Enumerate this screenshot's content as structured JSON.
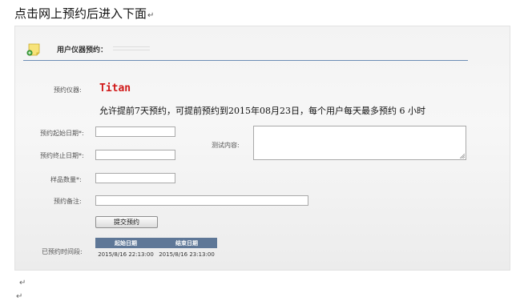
{
  "doc": {
    "heading": "点击网上预约后进入下面",
    "return_mark": "↵"
  },
  "panel": {
    "title": "用户仪器预约："
  },
  "form": {
    "instrument_label": "预约仪器:",
    "instrument_name": "Titan",
    "notice": "允许提前7天预约，可提前预约到2015年08月23日，每个用户每天最多预约 6 小时",
    "start_label": "预约起始日期*:",
    "start_value": "",
    "end_label": "预约终止日期*:",
    "end_value": "",
    "qty_label": "样品数量*:",
    "qty_value": "",
    "remark_label": "预约备注:",
    "remark_value": "",
    "content_label": "测试内容:",
    "content_value": "",
    "submit_label": "提交预约"
  },
  "booked": {
    "label": "已预约时间段:",
    "headers": [
      "起始日期",
      "结束日期"
    ],
    "rows": [
      [
        "2015/8/16 22:13:00",
        "2015/8/16 23:13:00"
      ]
    ]
  },
  "colors": {
    "instrument_name": "#d01818",
    "table_header": "#5e7797",
    "header_rule": "#6d8db5"
  }
}
